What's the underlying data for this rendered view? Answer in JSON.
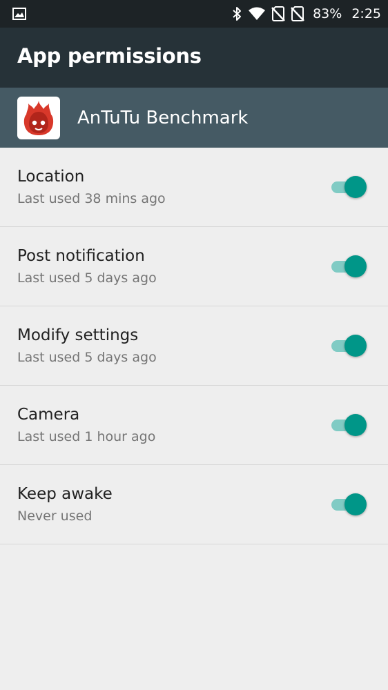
{
  "status_bar": {
    "left_icon": "image-notification-icon",
    "icons": [
      "bluetooth-icon",
      "wifi-icon",
      "no-sim-icon",
      "no-sim-icon"
    ],
    "battery": "83%",
    "clock": "2:25"
  },
  "app_bar": {
    "title": "App permissions"
  },
  "app": {
    "icon": "antutu-logo-icon",
    "name": "AnTuTu Benchmark"
  },
  "permissions": [
    {
      "title": "Location",
      "subtitle": "Last used 38 mins ago",
      "enabled": true
    },
    {
      "title": "Post notification",
      "subtitle": "Last used 5 days ago",
      "enabled": true
    },
    {
      "title": "Modify settings",
      "subtitle": "Last used 5 days ago",
      "enabled": true
    },
    {
      "title": "Camera",
      "subtitle": "Last used 1 hour ago",
      "enabled": true
    },
    {
      "title": "Keep awake",
      "subtitle": "Never used",
      "enabled": true
    }
  ],
  "colors": {
    "status_bar_bg": "#1d2326",
    "app_bar_bg": "#263238",
    "app_header_bg": "#455a64",
    "list_bg": "#eeeeee",
    "accent": "#009688",
    "accent_track": "#80cbc4"
  }
}
